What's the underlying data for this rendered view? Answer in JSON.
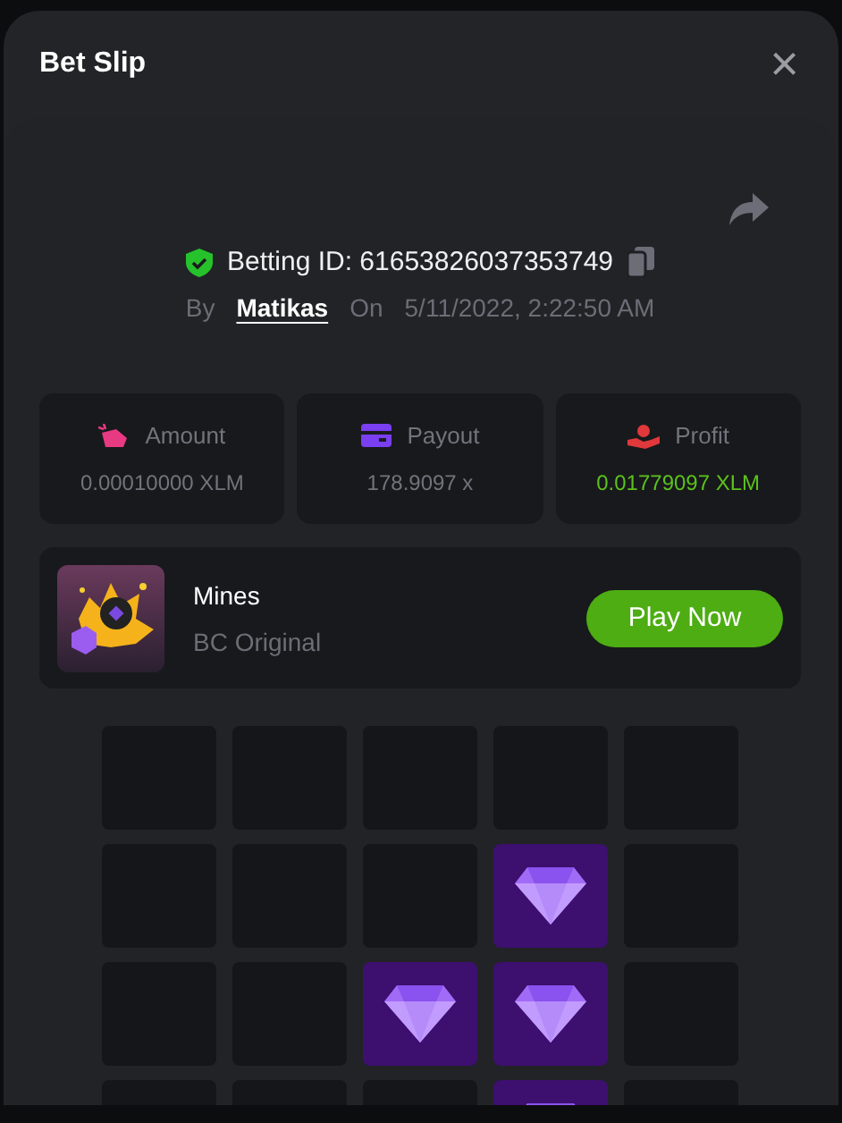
{
  "window": {
    "title": "Bet Slip",
    "close": "×"
  },
  "bet": {
    "id_label": "Betting ID: 61653826037353749",
    "by_label": "By",
    "user": "Matikas",
    "on_label": "On",
    "date": "5/11/2022, 2:22:50 AM"
  },
  "stats": [
    {
      "kind": "amount",
      "label": "Amount",
      "value": "0.00010000 XLM",
      "positive": false
    },
    {
      "kind": "payout",
      "label": "Payout",
      "value": "178.9097 x",
      "positive": false
    },
    {
      "kind": "profit",
      "label": "Profit",
      "value": "0.01779097 XLM",
      "positive": true
    }
  ],
  "game": {
    "name": "Mines",
    "provider": "BC Original",
    "button": "Play Now"
  },
  "grid": [
    [
      {
        "revealed": false
      },
      {
        "revealed": false
      },
      {
        "revealed": false
      },
      {
        "revealed": false
      },
      {
        "revealed": false
      }
    ],
    [
      {
        "revealed": false
      },
      {
        "revealed": false
      },
      {
        "revealed": false
      },
      {
        "revealed": true
      },
      {
        "revealed": false
      }
    ],
    [
      {
        "revealed": false
      },
      {
        "revealed": false
      },
      {
        "revealed": true
      },
      {
        "revealed": true
      },
      {
        "revealed": false
      }
    ],
    [
      {
        "revealed": false
      },
      {
        "revealed": false
      },
      {
        "revealed": false
      },
      {
        "revealed": true
      },
      {
        "revealed": false
      }
    ]
  ]
}
